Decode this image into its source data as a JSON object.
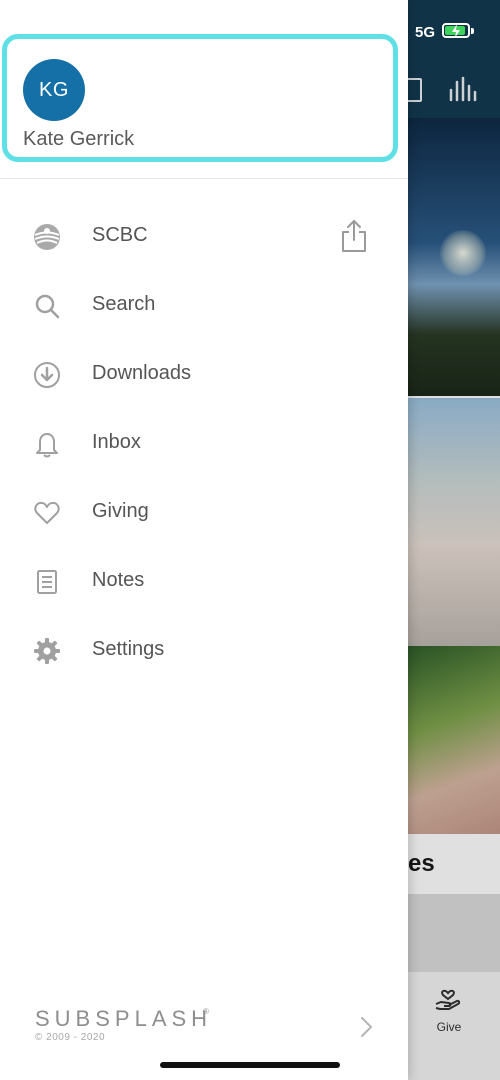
{
  "status_bar": {
    "network": "5G",
    "battery_level": 0.84
  },
  "background_app": {
    "partial_title": "es",
    "tab_give_label": "Give"
  },
  "drawer": {
    "profile": {
      "initials": "KG",
      "name": "Kate Gerrick",
      "avatar_color": "#1470a6",
      "highlight_color": "#5ee0e6"
    },
    "menu": [
      {
        "label": "SCBC",
        "icon": "church-logo-icon"
      },
      {
        "label": "Search",
        "icon": "search-icon"
      },
      {
        "label": "Downloads",
        "icon": "download-icon"
      },
      {
        "label": "Inbox",
        "icon": "bell-icon"
      },
      {
        "label": "Giving",
        "icon": "heart-icon"
      },
      {
        "label": "Notes",
        "icon": "notes-icon"
      },
      {
        "label": "Settings",
        "icon": "gear-icon"
      }
    ],
    "share_icon": "share-icon",
    "footer": {
      "brand": "SUBSPLASH",
      "registered": "®",
      "copyright": "© 2009 - 2020"
    }
  }
}
